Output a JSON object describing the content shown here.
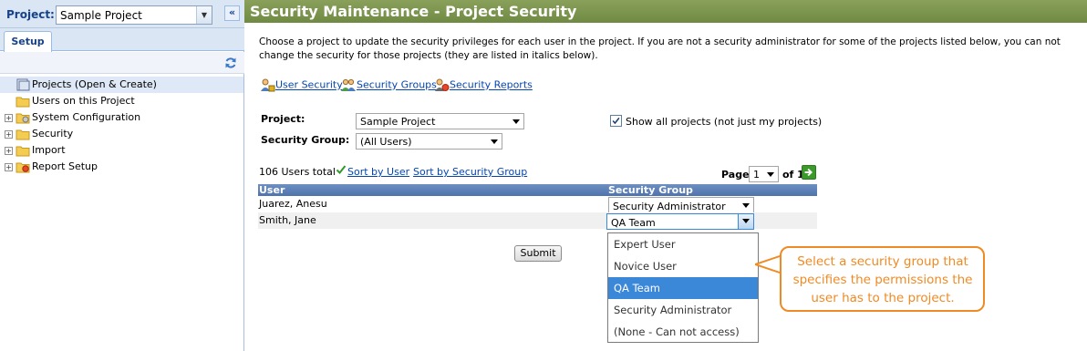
{
  "left_panel": {
    "project_label": "Project:",
    "project_value": "Sample Project",
    "collapse_glyph": "«",
    "tab_setup": "Setup",
    "tree": [
      {
        "label": "Projects (Open & Create)",
        "icon": "projects-icon",
        "expandable": false,
        "selected": true
      },
      {
        "label": "Users on this Project",
        "icon": "folder-icon",
        "expandable": false,
        "selected": false
      },
      {
        "label": "System Configuration",
        "icon": "gear-folder-icon",
        "expandable": true,
        "selected": false
      },
      {
        "label": "Security",
        "icon": "folder-icon",
        "expandable": true,
        "selected": false
      },
      {
        "label": "Import",
        "icon": "folder-icon",
        "expandable": true,
        "selected": false
      },
      {
        "label": "Report Setup",
        "icon": "report-folder-icon",
        "expandable": true,
        "selected": false
      }
    ]
  },
  "main": {
    "title": "Security Maintenance - Project Security",
    "intro": "Choose a project to update the security privileges for each user in the project.  If you are not a security administrator for some of the projects listed below, you can not change the security for those projects (they are listed in italics below).",
    "links": {
      "user_security": "User Security",
      "security_groups": "Security Groups",
      "security_reports": "Security Reports"
    },
    "form": {
      "project_label": "Project:",
      "project_value": "Sample Project",
      "group_label": "Security Group:",
      "group_value": "(All Users)",
      "show_all_label": "Show all projects (not just my projects)",
      "show_all_checked": true
    },
    "list_toolbar": {
      "users_total": "106 Users total",
      "sort_by_user": "Sort by User",
      "sort_by_group": "Sort by Security Group",
      "page_label": "Page",
      "page_value": "1",
      "page_of": "of 1"
    },
    "grid": {
      "headers": {
        "user": "User",
        "group": "Security Group"
      },
      "rows": [
        {
          "user": "Juarez, Anesu",
          "group": "Security Administrator"
        },
        {
          "user": "Smith, Jane",
          "group": "QA Team"
        }
      ]
    },
    "submit_label": "Submit",
    "dropdown_options": [
      {
        "label": "Expert User",
        "selected": false
      },
      {
        "label": "Novice User",
        "selected": false
      },
      {
        "label": "QA Team",
        "selected": true
      },
      {
        "label": "Security Administrator",
        "selected": false
      },
      {
        "label": "(None - Can not access)",
        "selected": false
      }
    ],
    "callout_text": "Select a security group that specifies the permissions the user has to the project."
  },
  "colors": {
    "title_bar": "#6f8a42",
    "grid_header": "#4f73ad",
    "callout": "#f08a24",
    "dropdown_highlight": "#3b87d8",
    "link": "#0645ad"
  }
}
